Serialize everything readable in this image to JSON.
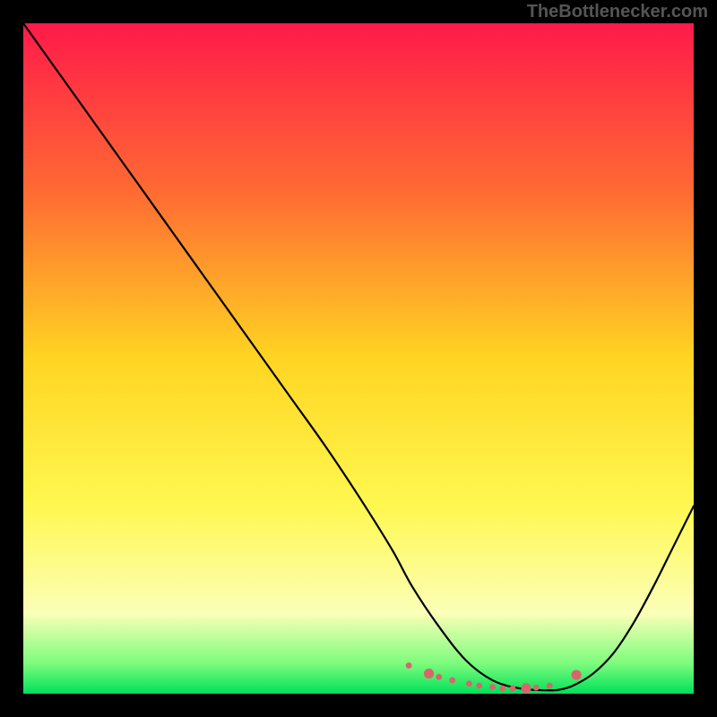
{
  "watermark": "TheBottlenecker.com",
  "chart_data": {
    "type": "line",
    "title": "",
    "xlabel": "",
    "ylabel": "",
    "xlim": [
      0,
      100
    ],
    "ylim": [
      0,
      100
    ],
    "grid": false,
    "legend": false,
    "background_gradient": {
      "type": "vertical",
      "stops": [
        {
          "offset": 0.0,
          "color": "#ff1a4a"
        },
        {
          "offset": 0.25,
          "color": "#ff6a33"
        },
        {
          "offset": 0.5,
          "color": "#ffd522"
        },
        {
          "offset": 0.72,
          "color": "#fff850"
        },
        {
          "offset": 0.88,
          "color": "#fbffb8"
        },
        {
          "offset": 0.955,
          "color": "#7cfc7c"
        },
        {
          "offset": 1.0,
          "color": "#00e05a"
        }
      ]
    },
    "series": [
      {
        "name": "curve",
        "color": "#000000",
        "width": 2.2,
        "x": [
          0,
          5,
          10,
          15,
          20,
          25,
          30,
          35,
          40,
          45,
          50,
          55,
          58,
          62,
          66,
          70,
          74,
          78,
          80,
          82,
          85,
          88,
          91,
          94,
          97,
          100
        ],
        "y": [
          100,
          93,
          86,
          79,
          72,
          65,
          58,
          51,
          44,
          37,
          29.5,
          21.5,
          16,
          10,
          5,
          2,
          0.8,
          0.5,
          0.6,
          1.2,
          3,
          6,
          10.5,
          16,
          22,
          28
        ]
      }
    ],
    "markers": {
      "color": "#d9646b",
      "radius_small": 3.4,
      "radius_large": 5.6,
      "points": [
        {
          "x": 57.5,
          "y": 4.2,
          "size": "small"
        },
        {
          "x": 60.5,
          "y": 3.0,
          "size": "large"
        },
        {
          "x": 62.0,
          "y": 2.5,
          "size": "small"
        },
        {
          "x": 64.0,
          "y": 2.0,
          "size": "small"
        },
        {
          "x": 66.5,
          "y": 1.5,
          "size": "small"
        },
        {
          "x": 68.0,
          "y": 1.2,
          "size": "small"
        },
        {
          "x": 70.0,
          "y": 1.0,
          "size": "small"
        },
        {
          "x": 71.5,
          "y": 0.8,
          "size": "small"
        },
        {
          "x": 73.0,
          "y": 0.8,
          "size": "small"
        },
        {
          "x": 75.0,
          "y": 0.8,
          "size": "large"
        },
        {
          "x": 76.5,
          "y": 0.9,
          "size": "small"
        },
        {
          "x": 78.5,
          "y": 1.2,
          "size": "small"
        },
        {
          "x": 82.5,
          "y": 2.8,
          "size": "large"
        }
      ]
    }
  }
}
